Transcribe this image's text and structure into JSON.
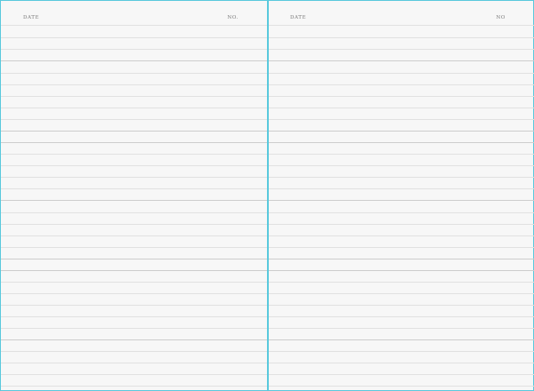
{
  "pages": [
    {
      "date_label": "DATE",
      "no_label": "NO."
    },
    {
      "date_label": "DATE",
      "no_label": "NO"
    }
  ],
  "colors": {
    "spine": "#59c9dd",
    "paper": "#f7f7f7",
    "rule": "#e1e1e1",
    "rule_heavy": "#cdcdcd",
    "label": "#7a7a7a"
  }
}
